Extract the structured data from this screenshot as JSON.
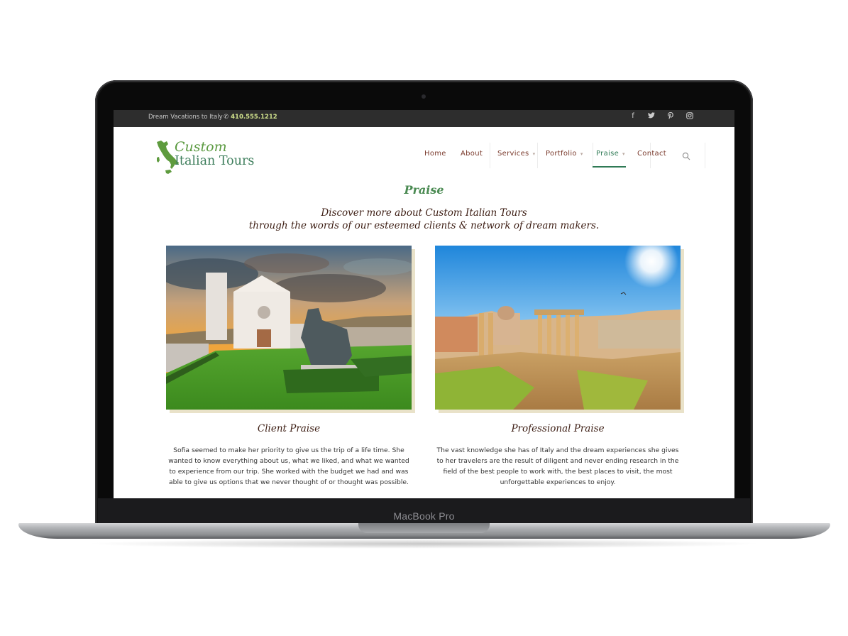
{
  "device": {
    "brand_label": "MacBook Pro"
  },
  "topbar": {
    "tagline": "Dream Vacations to Italy",
    "phone_icon": "phone-icon",
    "phone": "410.555.1212",
    "social": [
      {
        "name": "facebook-icon",
        "glyph": "f"
      },
      {
        "name": "twitter-icon",
        "glyph": "🐦"
      },
      {
        "name": "pinterest-icon",
        "glyph": "P"
      },
      {
        "name": "instagram-icon",
        "glyph": "◎"
      }
    ]
  },
  "logo": {
    "line1": "Custom",
    "line2": "Italian Tours",
    "icon": "italy-map-icon"
  },
  "nav": {
    "items": [
      {
        "label": "Home",
        "dropdown": false
      },
      {
        "label": "About",
        "dropdown": false
      },
      {
        "label": "Services",
        "dropdown": true
      },
      {
        "label": "Portfolio",
        "dropdown": true
      },
      {
        "label": "Praise",
        "dropdown": true,
        "active": true
      },
      {
        "label": "Contact",
        "dropdown": false
      }
    ],
    "caret": "▾",
    "search_icon": "search-icon",
    "active_color": "#2f7a55"
  },
  "page": {
    "title": "Praise",
    "intro_line1": "Discover more about Custom Italian Tours",
    "intro_line2": "through the words of our esteemed clients & network of dream makers."
  },
  "columns": [
    {
      "image": "Basilica of St. Francis of Assisi with statue at sunset",
      "title": "Client Praise",
      "text": "Sofia seemed to make her priority to give us the trip of a life time. She wanted to know everything about us, what we liked, and what we wanted to experience from our trip. She worked with the budget we had and was able to give us options that we never thought of or thought was possible."
    },
    {
      "image": "Roman Forum ruins under bright sun",
      "title": "Professional Praise",
      "text": "The vast knowledge she has of Italy and the dream experiences she gives to her travelers are the result of diligent and never ending research in the field of the best people to work with, the best places to visit, the most unforgettable experiences to enjoy."
    }
  ],
  "colors": {
    "topbar_bg": "#2d2d2d",
    "phone": "#cfe08c",
    "nav_text": "#7a3a2c",
    "title_green": "#4a8a52",
    "heading_brown": "#3d1e14",
    "logo_green": "#5b9a41",
    "photo_shadow": "#e9e2c9"
  }
}
